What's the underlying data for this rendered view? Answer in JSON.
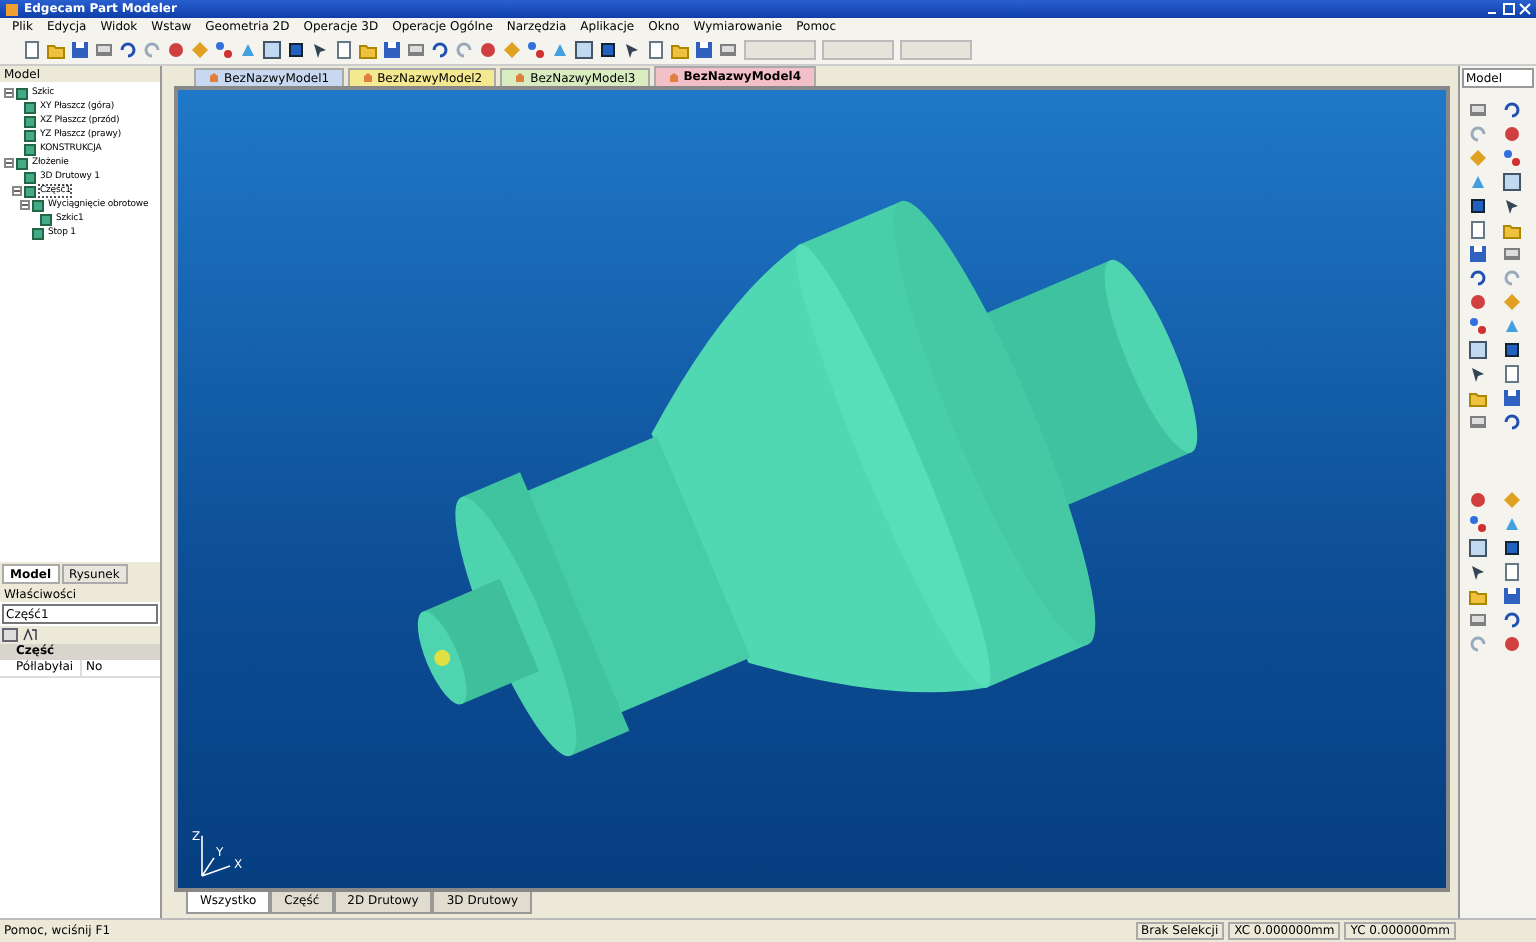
{
  "window": {
    "title": "Edgecam Part Modeler"
  },
  "menu": [
    "Plik",
    "Edycja",
    "Widok",
    "Wstaw",
    "Geometria 2D",
    "Operacje 3D",
    "Operacje Ogólne",
    "Narzędzia",
    "Aplikacje",
    "Okno",
    "Wymiarowanie",
    "Pomoc"
  ],
  "document_tabs": [
    {
      "label": "BezNazwyModel1",
      "color": "#c8d8f0",
      "selected": false
    },
    {
      "label": "BezNazwyModel2",
      "color": "#f4e890",
      "selected": false
    },
    {
      "label": "BezNazwyModel3",
      "color": "#d8ecc0",
      "selected": false
    },
    {
      "label": "BezNazwyModel4",
      "color": "#f4c0c8",
      "selected": true
    }
  ],
  "model_panel": {
    "title": "Model",
    "tree": [
      {
        "label": "Szkic",
        "expanded": true,
        "selected": false,
        "children": [
          {
            "label": "XY Płaszcz (góra)",
            "selected": false
          },
          {
            "label": "XZ Płaszcz (przód)",
            "selected": false
          },
          {
            "label": "YZ Płaszcz (prawy)",
            "selected": false
          },
          {
            "label": "KONSTRUKCJA",
            "selected": false
          }
        ]
      },
      {
        "label": "Złożenie",
        "expanded": true,
        "selected": false,
        "children": [
          {
            "label": "3D Drutowy 1",
            "selected": false
          },
          {
            "label": "Część1",
            "expanded": true,
            "selected": true,
            "children": [
              {
                "label": "Wyciągnięcie obrotowe",
                "expanded": true,
                "selected": false,
                "children": [
                  {
                    "label": "Szkic1",
                    "selected": false
                  }
                ]
              },
              {
                "label": "Stop 1",
                "selected": false
              }
            ]
          }
        ]
      }
    ]
  },
  "panel_tabs": [
    {
      "label": "Model",
      "selected": true
    },
    {
      "label": "Rysunek",
      "selected": false
    }
  ],
  "properties": {
    "title": "Właściwości",
    "object": "Część1",
    "section": "Część",
    "rows": [
      {
        "name": "Półlabyłai",
        "value": "No"
      }
    ]
  },
  "view_tabs": [
    {
      "label": "Wszystko",
      "selected": true
    },
    {
      "label": "Część",
      "selected": false
    },
    {
      "label": "2D Drutowy",
      "selected": false
    },
    {
      "label": "3D Drutowy",
      "selected": false
    }
  ],
  "axis_labels": [
    "X",
    "Y",
    "Z"
  ],
  "right_panel": {
    "title": "Model"
  },
  "status_bar": {
    "message": "Pomoc, wciśnij F1",
    "selection": "Brak Selekcji",
    "xc": "XC  0.000000mm",
    "yc": "YC  0.000000mm"
  }
}
